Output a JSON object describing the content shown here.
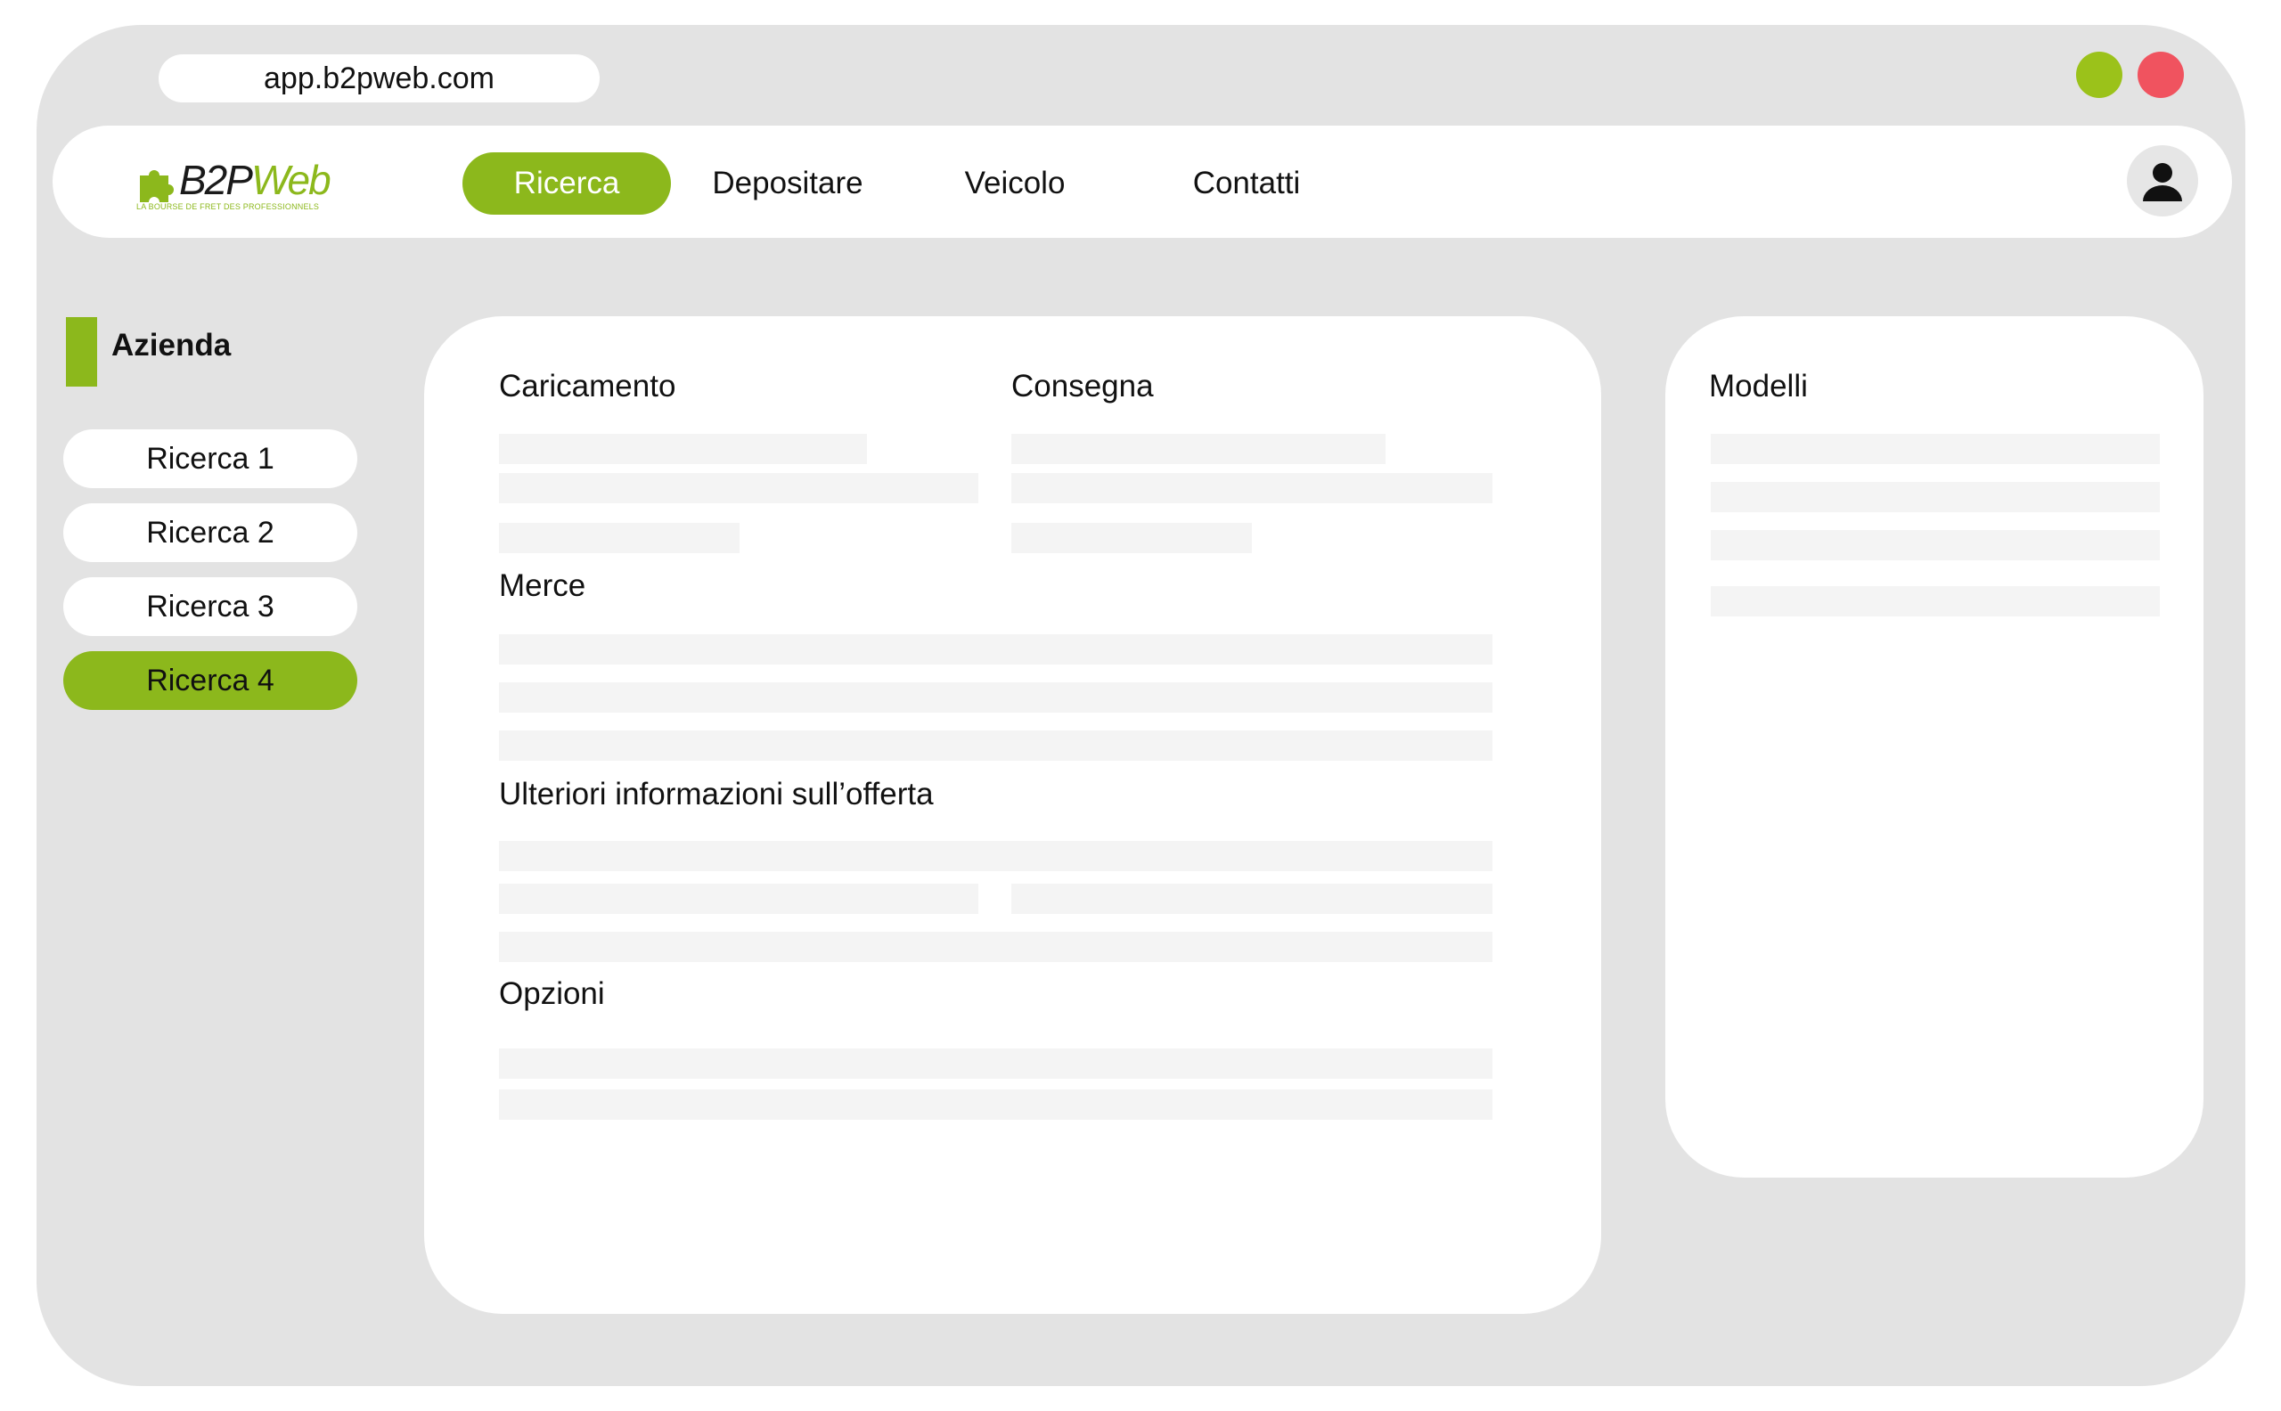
{
  "browser": {
    "url": "app.b2pweb.com",
    "window_buttons": [
      {
        "name": "minimize",
        "color": "#9bc21a"
      },
      {
        "name": "close",
        "color": "#f0535f"
      }
    ]
  },
  "header": {
    "logo": {
      "text_dark": "B2P",
      "text_accent": "Web",
      "tagline": "LA BOURSE DE FRET DES PROFESSIONNELS",
      "icon": "puzzle-piece-icon"
    },
    "nav": [
      {
        "label": "Ricerca",
        "active": true
      },
      {
        "label": "Depositare",
        "active": false
      },
      {
        "label": "Veicolo",
        "active": false
      },
      {
        "label": "Contatti",
        "active": false
      }
    ],
    "user_icon": "user-icon"
  },
  "sidebar": {
    "title": "Azienda",
    "items": [
      {
        "label": "Ricerca 1",
        "active": false
      },
      {
        "label": "Ricerca 2",
        "active": false
      },
      {
        "label": "Ricerca 3",
        "active": false
      },
      {
        "label": "Ricerca 4",
        "active": true
      }
    ]
  },
  "form": {
    "loading_label": "Caricamento",
    "delivery_label": "Consegna",
    "goods_label": "Merce",
    "extra_info_label": "Ulteriori informazioni sull’offerta",
    "options_label": "Opzioni"
  },
  "models": {
    "title": "Modelli"
  },
  "colors": {
    "accent": "#8cb81c",
    "background": "#e3e3e3",
    "placeholder": "#f4f4f4"
  }
}
